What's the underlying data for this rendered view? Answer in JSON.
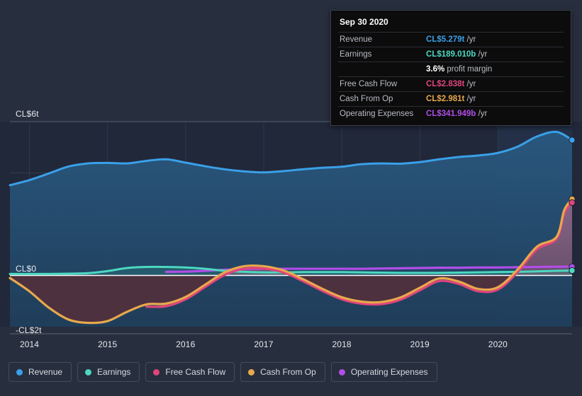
{
  "tooltip": {
    "date": "Sep 30 2020",
    "rows": [
      {
        "label": "Revenue",
        "value": "CL$5.279t",
        "unit": "/yr",
        "color": "#3aa0e8"
      },
      {
        "label": "Earnings",
        "value": "CL$189.010b",
        "unit": "/yr",
        "color": "#4cd8c0"
      },
      {
        "label": "Free Cash Flow",
        "value": "CL$2.838t",
        "unit": "/yr",
        "color": "#e0457b"
      },
      {
        "label": "Cash From Op",
        "value": "CL$2.981t",
        "unit": "/yr",
        "color": "#e8a84c"
      },
      {
        "label": "Operating Expenses",
        "value": "CL$341.949b",
        "unit": "/yr",
        "color": "#b14ee8"
      }
    ],
    "margin_value": "3.6%",
    "margin_label": "profit margin"
  },
  "legend": {
    "items": [
      {
        "label": "Revenue",
        "color": "#3aa0e8"
      },
      {
        "label": "Earnings",
        "color": "#4cd8c0"
      },
      {
        "label": "Free Cash Flow",
        "color": "#e0457b"
      },
      {
        "label": "Cash From Op",
        "color": "#e8a84c"
      },
      {
        "label": "Operating Expenses",
        "color": "#b14ee8"
      }
    ]
  },
  "chart_data": {
    "type": "area",
    "title": "",
    "xlabel": "",
    "ylabel": "",
    "currency": "CL$",
    "ylim": [
      -2,
      6
    ],
    "y_ticks": [
      {
        "value": 6,
        "label": "CL$6t"
      },
      {
        "value": 0,
        "label": "CL$0"
      },
      {
        "value": -2,
        "label": "-CL$2t"
      }
    ],
    "gridlines_y": [
      6,
      4,
      2,
      0
    ],
    "x_ticks": [
      "2014",
      "2015",
      "2016",
      "2017",
      "2018",
      "2019",
      "2020"
    ],
    "xlim": [
      2013.75,
      2020.95
    ],
    "grid": true,
    "legend_position": "bottom",
    "forecast_band_start": 2020.0,
    "series": [
      {
        "name": "Revenue",
        "color": "#3aa0e8",
        "fill": "#24496b",
        "points": [
          [
            2013.75,
            3.52
          ],
          [
            2014.0,
            3.72
          ],
          [
            2014.25,
            3.98
          ],
          [
            2014.5,
            4.25
          ],
          [
            2014.75,
            4.37
          ],
          [
            2015.0,
            4.39
          ],
          [
            2015.25,
            4.37
          ],
          [
            2015.5,
            4.47
          ],
          [
            2015.75,
            4.53
          ],
          [
            2016.0,
            4.4
          ],
          [
            2016.25,
            4.26
          ],
          [
            2016.5,
            4.14
          ],
          [
            2016.75,
            4.06
          ],
          [
            2017.0,
            4.02
          ],
          [
            2017.25,
            4.07
          ],
          [
            2017.5,
            4.14
          ],
          [
            2017.75,
            4.2
          ],
          [
            2018.0,
            4.24
          ],
          [
            2018.25,
            4.34
          ],
          [
            2018.5,
            4.37
          ],
          [
            2018.75,
            4.36
          ],
          [
            2019.0,
            4.42
          ],
          [
            2019.25,
            4.53
          ],
          [
            2019.5,
            4.62
          ],
          [
            2019.75,
            4.68
          ],
          [
            2020.0,
            4.78
          ],
          [
            2020.25,
            5.02
          ],
          [
            2020.5,
            5.42
          ],
          [
            2020.75,
            5.6
          ],
          [
            2020.95,
            5.28
          ]
        ]
      },
      {
        "name": "Earnings",
        "color": "#4cd8c0",
        "points": [
          [
            2013.75,
            0.06
          ],
          [
            2014.0,
            0.06
          ],
          [
            2014.25,
            0.06
          ],
          [
            2014.5,
            0.07
          ],
          [
            2014.75,
            0.09
          ],
          [
            2015.0,
            0.17
          ],
          [
            2015.25,
            0.29
          ],
          [
            2015.5,
            0.33
          ],
          [
            2015.75,
            0.33
          ],
          [
            2016.0,
            0.31
          ],
          [
            2016.25,
            0.26
          ],
          [
            2016.5,
            0.18
          ],
          [
            2016.75,
            0.14
          ],
          [
            2017.0,
            0.12
          ],
          [
            2017.25,
            0.12
          ],
          [
            2017.5,
            0.13
          ],
          [
            2017.75,
            0.13
          ],
          [
            2018.0,
            0.13
          ],
          [
            2018.25,
            0.12
          ],
          [
            2018.5,
            0.11
          ],
          [
            2018.75,
            0.1
          ],
          [
            2019.0,
            0.1
          ],
          [
            2019.25,
            0.1
          ],
          [
            2019.5,
            0.11
          ],
          [
            2019.75,
            0.12
          ],
          [
            2020.0,
            0.13
          ],
          [
            2020.25,
            0.14
          ],
          [
            2020.5,
            0.16
          ],
          [
            2020.75,
            0.18
          ],
          [
            2020.95,
            0.19
          ]
        ]
      },
      {
        "name": "Free Cash Flow",
        "color": "#e0457b",
        "points": [
          [
            2015.5,
            -1.22
          ],
          [
            2015.75,
            -1.2
          ],
          [
            2016.0,
            -0.93
          ],
          [
            2016.25,
            -0.45
          ],
          [
            2016.5,
            0.02
          ],
          [
            2016.75,
            0.26
          ],
          [
            2017.0,
            0.27
          ],
          [
            2017.25,
            0.12
          ],
          [
            2017.5,
            -0.22
          ],
          [
            2017.75,
            -0.6
          ],
          [
            2018.0,
            -0.93
          ],
          [
            2018.25,
            -1.1
          ],
          [
            2018.5,
            -1.12
          ],
          [
            2018.75,
            -0.95
          ],
          [
            2019.0,
            -0.58
          ],
          [
            2019.25,
            -0.22
          ],
          [
            2019.5,
            -0.33
          ],
          [
            2019.75,
            -0.62
          ],
          [
            2020.0,
            -0.55
          ],
          [
            2020.25,
            0.12
          ],
          [
            2020.5,
            1.02
          ],
          [
            2020.75,
            1.42
          ],
          [
            2020.85,
            2.42
          ],
          [
            2020.95,
            2.84
          ]
        ]
      },
      {
        "name": "Cash From Op",
        "color": "#e8a84c",
        "points": [
          [
            2013.75,
            -0.1
          ],
          [
            2014.0,
            -0.62
          ],
          [
            2014.25,
            -1.26
          ],
          [
            2014.5,
            -1.72
          ],
          [
            2014.75,
            -1.85
          ],
          [
            2015.0,
            -1.78
          ],
          [
            2015.25,
            -1.42
          ],
          [
            2015.5,
            -1.13
          ],
          [
            2015.75,
            -1.1
          ],
          [
            2016.0,
            -0.84
          ],
          [
            2016.25,
            -0.36
          ],
          [
            2016.5,
            0.12
          ],
          [
            2016.75,
            0.36
          ],
          [
            2017.0,
            0.36
          ],
          [
            2017.25,
            0.2
          ],
          [
            2017.5,
            -0.14
          ],
          [
            2017.75,
            -0.52
          ],
          [
            2018.0,
            -0.85
          ],
          [
            2018.25,
            -1.02
          ],
          [
            2018.5,
            -1.04
          ],
          [
            2018.75,
            -0.86
          ],
          [
            2019.0,
            -0.48
          ],
          [
            2019.25,
            -0.12
          ],
          [
            2019.5,
            -0.24
          ],
          [
            2019.75,
            -0.53
          ],
          [
            2020.0,
            -0.46
          ],
          [
            2020.25,
            0.22
          ],
          [
            2020.5,
            1.12
          ],
          [
            2020.75,
            1.5
          ],
          [
            2020.85,
            2.55
          ],
          [
            2020.95,
            2.98
          ]
        ]
      },
      {
        "name": "Operating Expenses",
        "color": "#b14ee8",
        "points": [
          [
            2015.75,
            0.14
          ],
          [
            2016.0,
            0.15
          ],
          [
            2016.25,
            0.18
          ],
          [
            2016.5,
            0.22
          ],
          [
            2016.75,
            0.25
          ],
          [
            2017.0,
            0.26
          ],
          [
            2017.25,
            0.26
          ],
          [
            2017.5,
            0.26
          ],
          [
            2017.75,
            0.26
          ],
          [
            2018.0,
            0.26
          ],
          [
            2018.25,
            0.26
          ],
          [
            2018.5,
            0.27
          ],
          [
            2018.75,
            0.28
          ],
          [
            2019.0,
            0.29
          ],
          [
            2019.25,
            0.3
          ],
          [
            2019.5,
            0.3
          ],
          [
            2019.75,
            0.31
          ],
          [
            2020.0,
            0.31
          ],
          [
            2020.25,
            0.32
          ],
          [
            2020.5,
            0.33
          ],
          [
            2020.75,
            0.34
          ],
          [
            2020.95,
            0.34
          ]
        ]
      }
    ]
  }
}
